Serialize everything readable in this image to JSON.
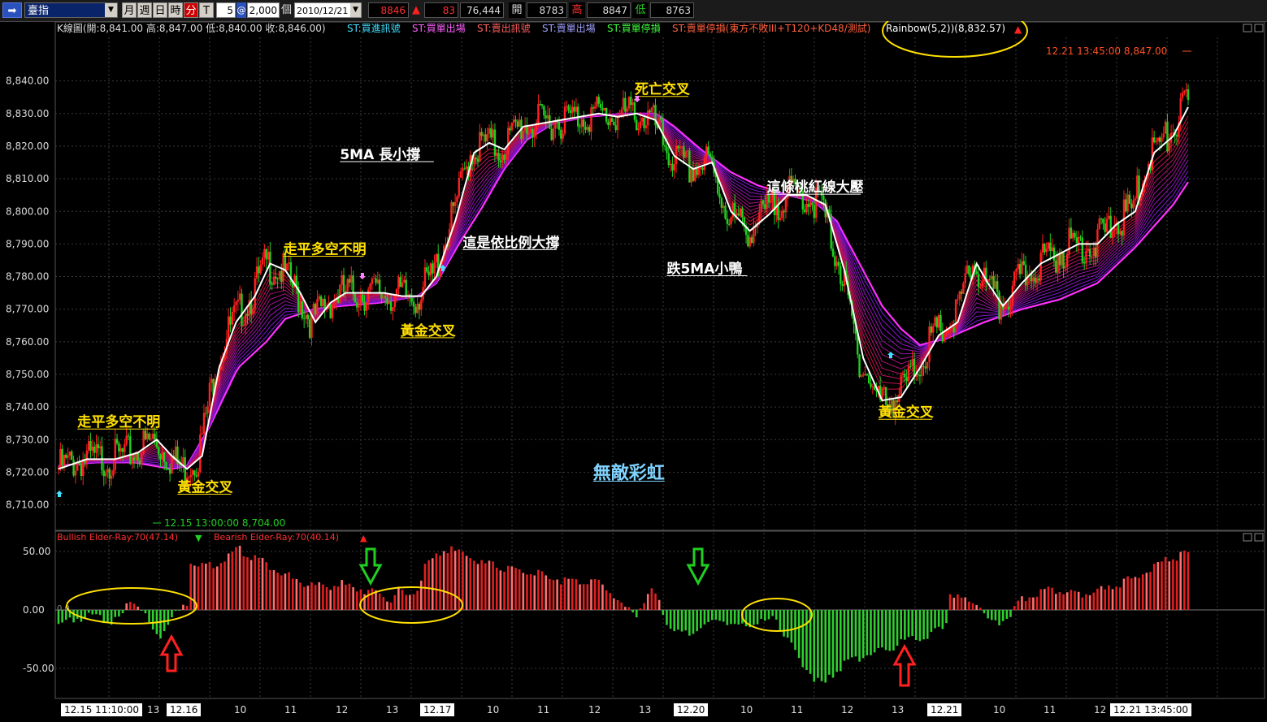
{
  "toolbar": {
    "nav_icon": "arrow-right-icon",
    "symbol": "臺指",
    "periods": [
      "月",
      "週",
      "日",
      "時",
      "分",
      "T"
    ],
    "active_period": 4,
    "interval": "5",
    "at_symbol": "@",
    "quantity": "2,000",
    "unit": "個",
    "date": "2010/12/21",
    "quote_last": "8846",
    "quote_arrow": "▲",
    "quote_change": "83",
    "quote_volume": "76,444",
    "open_label": "開",
    "open_value": "8783",
    "high_label": "高",
    "high_value": "8847",
    "low_label": "低",
    "low_value": "8763"
  },
  "legend": {
    "kline": "K線圖(開:8,841.00 高:8,847.00 低:8,840.00 收:8,846.00)",
    "st1": "ST:買進訊號",
    "st2": "ST:買單出場",
    "st3": "ST:賣出訊號",
    "st4": "ST:賣單出場",
    "st5": "ST:買單停損",
    "st6": "ST:賣單停損(東方不敗III+T120+KD48/測試)",
    "rainbow": "Rainbow(5,2))(8,832.57)"
  },
  "colors": {
    "background": "#000000",
    "up_candle": "#ff2020",
    "down_candle": "#20d020",
    "ma_line": "#ffffff",
    "rainbow_outer": "#ff30ff",
    "annotation": "#ffe000",
    "grid": "#3a3a3a"
  },
  "chart_data": [
    {
      "type": "candlestick",
      "title": "",
      "y_ticks": [
        "8,710.00",
        "8,720.00",
        "8,730.00",
        "8,740.00",
        "8,750.00",
        "8,760.00",
        "8,770.00",
        "8,780.00",
        "8,790.00",
        "8,800.00",
        "8,810.00",
        "8,820.00",
        "8,830.00",
        "8,840.00"
      ],
      "ylim": [
        8704,
        8848
      ],
      "last_label": "12.21 13:45:00  8,847.00",
      "low_label": "12.15 13:00:00  8,704.00",
      "ma5_key": [
        [
          0,
          8721
        ],
        [
          15,
          8724
        ],
        [
          30,
          8724
        ],
        [
          42,
          8726
        ],
        [
          52,
          8730
        ],
        [
          60,
          8725
        ],
        [
          68,
          8721
        ],
        [
          76,
          8725
        ],
        [
          85,
          8752
        ],
        [
          94,
          8766
        ],
        [
          104,
          8774
        ],
        [
          112,
          8784
        ],
        [
          120,
          8782
        ],
        [
          128,
          8775
        ],
        [
          136,
          8766
        ],
        [
          144,
          8772
        ],
        [
          152,
          8775
        ],
        [
          162,
          8775
        ],
        [
          172,
          8775
        ],
        [
          182,
          8774
        ],
        [
          192,
          8774
        ],
        [
          200,
          8780
        ],
        [
          210,
          8797
        ],
        [
          220,
          8818
        ],
        [
          228,
          8821
        ],
        [
          236,
          8819
        ],
        [
          246,
          8826
        ],
        [
          256,
          8827
        ],
        [
          266,
          8828
        ],
        [
          276,
          8829
        ],
        [
          286,
          8830
        ],
        [
          296,
          8829
        ],
        [
          306,
          8830
        ],
        [
          316,
          8828
        ],
        [
          326,
          8817
        ],
        [
          336,
          8813
        ],
        [
          346,
          8815
        ],
        [
          356,
          8800
        ],
        [
          366,
          8794
        ],
        [
          376,
          8799
        ],
        [
          386,
          8805
        ],
        [
          396,
          8805
        ],
        [
          406,
          8802
        ],
        [
          416,
          8782
        ],
        [
          426,
          8755
        ],
        [
          436,
          8742
        ],
        [
          446,
          8743
        ],
        [
          456,
          8752
        ],
        [
          466,
          8762
        ],
        [
          476,
          8766
        ],
        [
          486,
          8784
        ],
        [
          492,
          8778
        ],
        [
          500,
          8771
        ],
        [
          510,
          8778
        ],
        [
          520,
          8784
        ],
        [
          530,
          8787
        ],
        [
          540,
          8790
        ],
        [
          550,
          8790
        ],
        [
          560,
          8796
        ],
        [
          570,
          8800
        ],
        [
          580,
          8818
        ],
        [
          590,
          8823
        ],
        [
          598,
          8832
        ]
      ],
      "outer_key": [
        [
          0,
          8722
        ],
        [
          20,
          8723
        ],
        [
          40,
          8723
        ],
        [
          60,
          8721
        ],
        [
          68,
          8722
        ],
        [
          80,
          8734
        ],
        [
          95,
          8752
        ],
        [
          110,
          8760
        ],
        [
          120,
          8767
        ],
        [
          135,
          8770
        ],
        [
          150,
          8771
        ],
        [
          170,
          8772
        ],
        [
          190,
          8774
        ],
        [
          200,
          8778
        ],
        [
          212,
          8790
        ],
        [
          224,
          8801
        ],
        [
          236,
          8813
        ],
        [
          248,
          8822
        ],
        [
          262,
          8827
        ],
        [
          280,
          8829
        ],
        [
          300,
          8830
        ],
        [
          316,
          8830
        ],
        [
          326,
          8826
        ],
        [
          340,
          8819
        ],
        [
          356,
          8812
        ],
        [
          370,
          8808
        ],
        [
          386,
          8805
        ],
        [
          400,
          8803
        ],
        [
          412,
          8797
        ],
        [
          424,
          8784
        ],
        [
          436,
          8771
        ],
        [
          446,
          8764
        ],
        [
          456,
          8759
        ],
        [
          470,
          8761
        ],
        [
          490,
          8766
        ],
        [
          510,
          8770
        ],
        [
          530,
          8773
        ],
        [
          550,
          8778
        ],
        [
          570,
          8789
        ],
        [
          590,
          8802
        ],
        [
          598,
          8809
        ]
      ],
      "annotations": [
        {
          "text": "走平多空不明",
          "x": 10,
          "y": 8734,
          "color": "#ffe000"
        },
        {
          "text": "黃金交叉",
          "x": 63,
          "y": 8714,
          "color": "#ffe000"
        },
        {
          "text": "走平多空不明",
          "x": 119,
          "y": 8787,
          "color": "#ffe000"
        },
        {
          "text": "黃金交叉",
          "x": 181,
          "y": 8762,
          "color": "#ffe000"
        },
        {
          "text": "5MA 長小撐",
          "x": 149,
          "y": 8816,
          "color": "#ffffff"
        },
        {
          "text": "這是依比例大撐",
          "x": 214,
          "y": 8789,
          "color": "#ffffff"
        },
        {
          "text": "死亡交叉",
          "x": 305,
          "y": 8836,
          "color": "#ffe000"
        },
        {
          "text": "這條桃紅線大壓",
          "x": 375,
          "y": 8806,
          "color": "#ffffff"
        },
        {
          "text": "跌5MA小鴨",
          "x": 322,
          "y": 8781,
          "color": "#ffffff"
        },
        {
          "text": "黃金交叉",
          "x": 434,
          "y": 8737,
          "color": "#ffe000"
        },
        {
          "text": "無敵彩虹",
          "x": 283,
          "y": 8718,
          "color": "#7fd4ff"
        }
      ]
    },
    {
      "type": "bar",
      "title": "",
      "legend": [
        {
          "name": "Bullish Elder-Ray:70(47.14)",
          "arrow": "▼",
          "color": "#ff3030",
          "arrow_color": "#20d020"
        },
        {
          "name": "Bearish Elder-Ray:70(40.14)",
          "arrow": "▲",
          "color": "#ff3030",
          "arrow_color": "#ff2020"
        }
      ],
      "y_ticks": [
        "50.00",
        "0.00",
        "-50.00"
      ],
      "ylim": [
        -72,
        58
      ],
      "zero_label": "0.0",
      "key": [
        [
          0,
          -12
        ],
        [
          8,
          -8
        ],
        [
          15,
          -6
        ],
        [
          22,
          -7
        ],
        [
          30,
          -10
        ],
        [
          35,
          -2
        ],
        [
          38,
          9
        ],
        [
          42,
          5
        ],
        [
          46,
          -4
        ],
        [
          50,
          -18
        ],
        [
          54,
          -22
        ],
        [
          58,
          -10
        ],
        [
          62,
          -4
        ],
        [
          66,
          2
        ],
        [
          68,
          6
        ],
        [
          70,
          42
        ],
        [
          80,
          38
        ],
        [
          90,
          45
        ],
        [
          95,
          52
        ],
        [
          100,
          48
        ],
        [
          110,
          40
        ],
        [
          120,
          30
        ],
        [
          130,
          22
        ],
        [
          140,
          20
        ],
        [
          150,
          22
        ],
        [
          160,
          18
        ],
        [
          170,
          14
        ],
        [
          175,
          8
        ],
        [
          180,
          16
        ],
        [
          185,
          12
        ],
        [
          190,
          18
        ],
        [
          195,
          40
        ],
        [
          205,
          52
        ],
        [
          215,
          47
        ],
        [
          225,
          40
        ],
        [
          235,
          36
        ],
        [
          245,
          33
        ],
        [
          255,
          30
        ],
        [
          265,
          26
        ],
        [
          275,
          24
        ],
        [
          285,
          25
        ],
        [
          290,
          18
        ],
        [
          295,
          10
        ],
        [
          300,
          2
        ],
        [
          305,
          -6
        ],
        [
          310,
          8
        ],
        [
          315,
          18
        ],
        [
          318,
          5
        ],
        [
          322,
          -12
        ],
        [
          330,
          -22
        ],
        [
          340,
          -15
        ],
        [
          350,
          -8
        ],
        [
          360,
          -14
        ],
        [
          370,
          -12
        ],
        [
          380,
          -8
        ],
        [
          385,
          -22
        ],
        [
          392,
          -42
        ],
        [
          400,
          -58
        ],
        [
          405,
          -64
        ],
        [
          412,
          -52
        ],
        [
          420,
          -42
        ],
        [
          430,
          -38
        ],
        [
          440,
          -32
        ],
        [
          450,
          -26
        ],
        [
          460,
          -22
        ],
        [
          466,
          -18
        ],
        [
          470,
          -10
        ],
        [
          472,
          14
        ],
        [
          480,
          8
        ],
        [
          488,
          4
        ],
        [
          490,
          -6
        ],
        [
          495,
          -14
        ],
        [
          500,
          -8
        ],
        [
          505,
          -2
        ],
        [
          510,
          8
        ],
        [
          520,
          16
        ],
        [
          530,
          18
        ],
        [
          540,
          14
        ],
        [
          550,
          16
        ],
        [
          560,
          20
        ],
        [
          570,
          28
        ],
        [
          580,
          38
        ],
        [
          590,
          44
        ],
        [
          597,
          48
        ]
      ]
    }
  ],
  "x_labels": [
    {
      "text": "12.15 11:10:00",
      "boxed": true
    },
    {
      "text": "13",
      "boxed": false
    },
    {
      "text": "12.16",
      "boxed": true
    },
    {
      "text": "10",
      "boxed": false
    },
    {
      "text": "11",
      "boxed": false
    },
    {
      "text": "12",
      "boxed": false
    },
    {
      "text": "13",
      "boxed": false
    },
    {
      "text": "12.17",
      "boxed": true
    },
    {
      "text": "10",
      "boxed": false
    },
    {
      "text": "11",
      "boxed": false
    },
    {
      "text": "12",
      "boxed": false
    },
    {
      "text": "13",
      "boxed": false
    },
    {
      "text": "12.20",
      "boxed": true
    },
    {
      "text": "10",
      "boxed": false
    },
    {
      "text": "11",
      "boxed": false
    },
    {
      "text": "12",
      "boxed": false
    },
    {
      "text": "13",
      "boxed": false
    },
    {
      "text": "12.21",
      "boxed": true
    },
    {
      "text": "10",
      "boxed": false
    },
    {
      "text": "11",
      "boxed": false
    },
    {
      "text": "12",
      "boxed": false
    },
    {
      "text": "12.21 13:45:00",
      "boxed": true
    }
  ]
}
